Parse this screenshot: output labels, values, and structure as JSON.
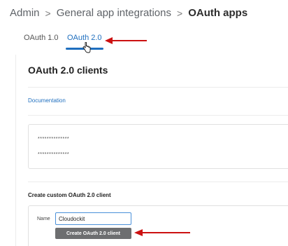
{
  "breadcrumb": {
    "items": [
      "Admin",
      "General app integrations",
      "OAuth apps"
    ],
    "separator": ">"
  },
  "tabs": [
    {
      "label": "OAuth 1.0",
      "active": false
    },
    {
      "label": "OAuth 2.0",
      "active": true
    }
  ],
  "main": {
    "title": "OAuth 2.0 clients",
    "documentation_link": "Documentation",
    "client_secrets": [
      "**************",
      "**************"
    ]
  },
  "create_section": {
    "title": "Create custom OAuth 2.0 client",
    "name_label": "Name",
    "name_value": "Cloudockit",
    "button_label": "Create OAuth 2.0 client"
  },
  "colors": {
    "accent": "#1f6fbf",
    "button": "#6d6e70",
    "annotation_arrow": "#cc1111"
  },
  "icons": {
    "cursor": "hand-pointer-icon",
    "arrows": "red-arrow-annotation-icon"
  }
}
